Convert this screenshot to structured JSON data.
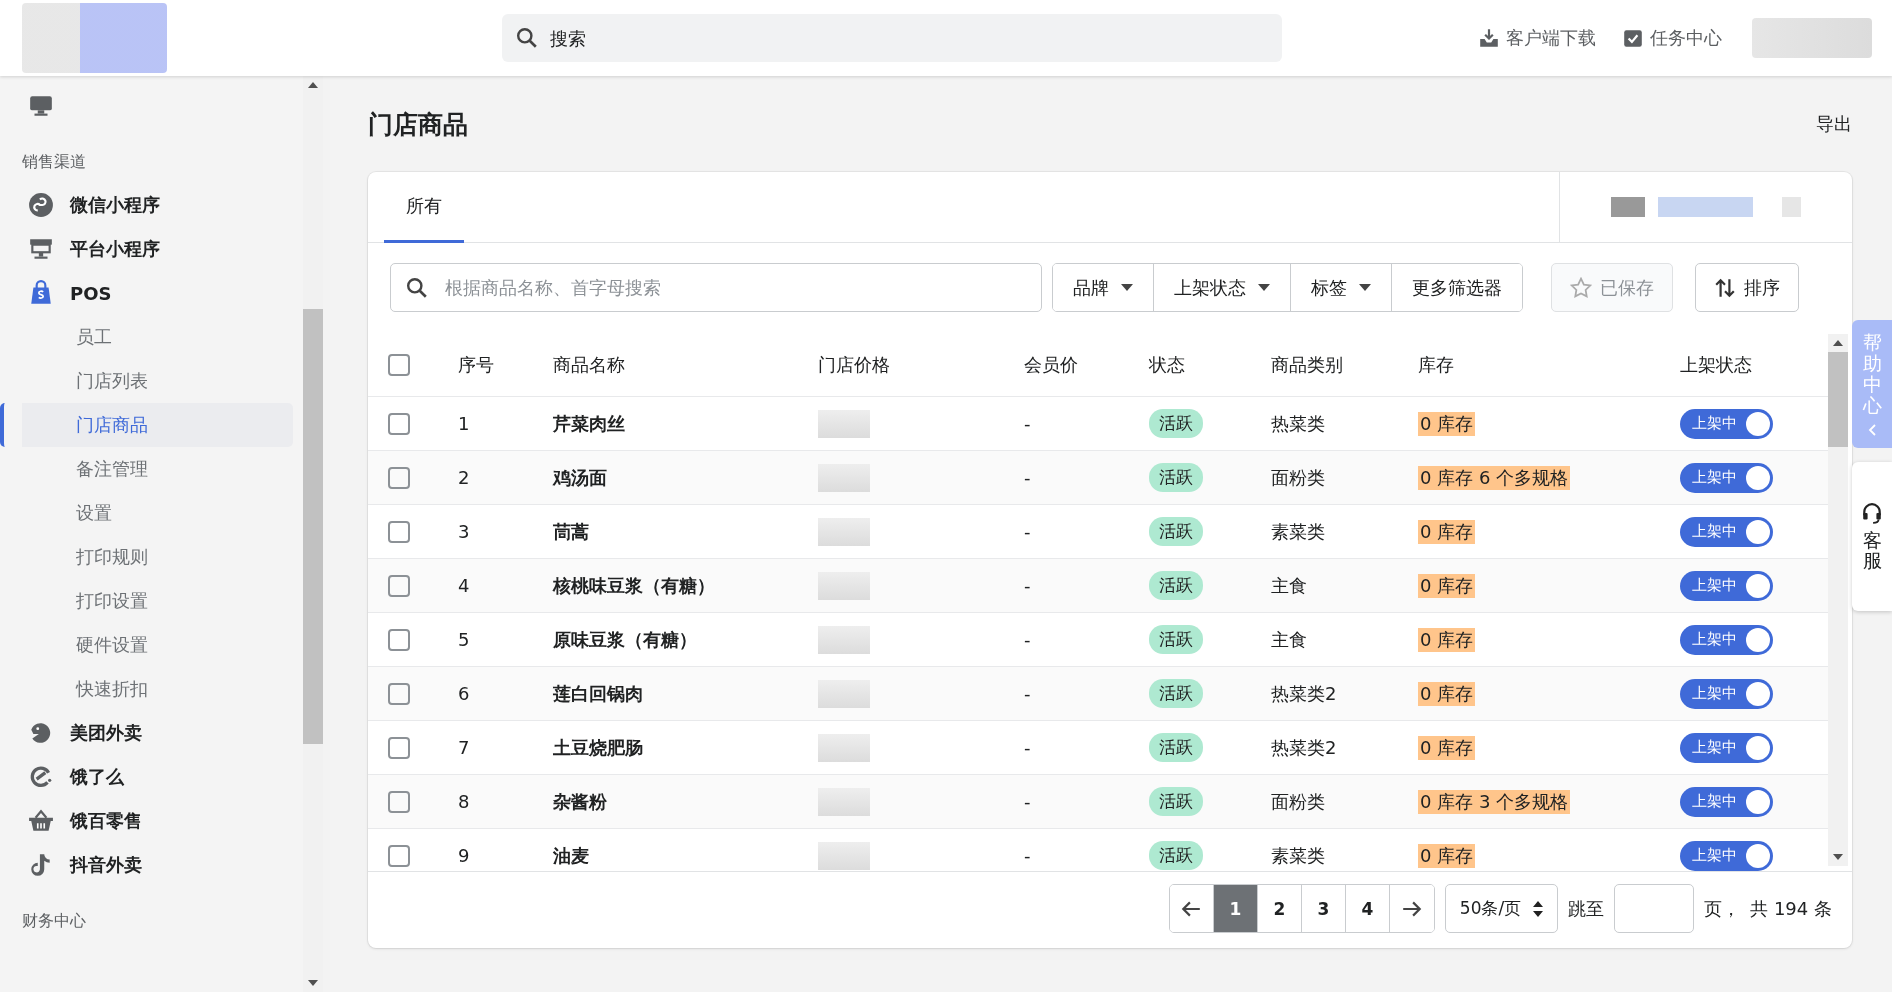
{
  "header": {
    "search_placeholder": "搜索",
    "links": [
      {
        "label": "客户端下载"
      },
      {
        "label": "任务中心"
      }
    ]
  },
  "sidebar": {
    "items": [
      {
        "kind": "channel",
        "selected": false
      },
      {
        "kind": "heading",
        "label": "销售渠道"
      },
      {
        "kind": "channel",
        "label": "微信小程序",
        "selected": false
      },
      {
        "kind": "channel",
        "label": "平台小程序",
        "selected": false
      },
      {
        "kind": "channel",
        "label": "POS",
        "selected": false
      },
      {
        "kind": "sub",
        "label": "员工",
        "selected": false
      },
      {
        "kind": "sub",
        "label": "门店列表",
        "selected": false
      },
      {
        "kind": "sub",
        "label": "门店商品",
        "selected": true
      },
      {
        "kind": "sub",
        "label": "备注管理",
        "selected": false
      },
      {
        "kind": "sub",
        "label": "设置",
        "selected": false
      },
      {
        "kind": "sub",
        "label": "打印规则",
        "selected": false
      },
      {
        "kind": "sub",
        "label": "打印设置",
        "selected": false
      },
      {
        "kind": "sub",
        "label": "硬件设置",
        "selected": false
      },
      {
        "kind": "sub",
        "label": "快速折扣",
        "selected": false
      },
      {
        "kind": "channel",
        "label": "美团外卖",
        "selected": false
      },
      {
        "kind": "channel",
        "label": "饿了么",
        "selected": false
      },
      {
        "kind": "channel",
        "label": "饿百零售",
        "selected": false
      },
      {
        "kind": "channel",
        "label": "抖音外卖",
        "selected": false
      },
      {
        "kind": "heading",
        "label": "财务中心"
      }
    ]
  },
  "page": {
    "title": "门店商品",
    "action": "导出"
  },
  "tabs": [
    {
      "label": "所有",
      "selected": true
    }
  ],
  "toolbar": {
    "search_placeholder": "根据商品名称、首字母搜索",
    "filters": [
      {
        "label": "品牌",
        "dropdown": true
      },
      {
        "label": "上架状态",
        "dropdown": true
      },
      {
        "label": "标签",
        "dropdown": true
      },
      {
        "label": "更多筛选器",
        "dropdown": false
      }
    ],
    "saved": {
      "label": "已保存",
      "disabled": true
    },
    "sort": {
      "label": "排序"
    }
  },
  "table": {
    "all_checked": false,
    "columns": [
      "序号",
      "商品名称",
      "门店价格",
      "会员价",
      "状态",
      "商品类别",
      "库存",
      "上架状态"
    ],
    "rows": [
      {
        "checked": false,
        "index": "1",
        "name": "芹菜肉丝",
        "member_price": "-",
        "status": "活跃",
        "category": "热菜类",
        "stock": "0 库存",
        "listing": "上架中",
        "on": true
      },
      {
        "checked": false,
        "index": "2",
        "name": "鸡汤面",
        "member_price": "-",
        "status": "活跃",
        "category": "面粉类",
        "stock": "0 库存 6 个多规格",
        "listing": "上架中",
        "on": true
      },
      {
        "checked": false,
        "index": "3",
        "name": "茼蒿",
        "member_price": "-",
        "status": "活跃",
        "category": "素菜类",
        "stock": "0 库存",
        "listing": "上架中",
        "on": true
      },
      {
        "checked": false,
        "index": "4",
        "name": "核桃味豆浆（有糖）",
        "member_price": "-",
        "status": "活跃",
        "category": "主食",
        "stock": "0 库存",
        "listing": "上架中",
        "on": true
      },
      {
        "checked": false,
        "index": "5",
        "name": "原味豆浆（有糖）",
        "member_price": "-",
        "status": "活跃",
        "category": "主食",
        "stock": "0 库存",
        "listing": "上架中",
        "on": true
      },
      {
        "checked": false,
        "index": "6",
        "name": "莲白回锅肉",
        "member_price": "-",
        "status": "活跃",
        "category": "热菜类2",
        "stock": "0 库存",
        "listing": "上架中",
        "on": true
      },
      {
        "checked": false,
        "index": "7",
        "name": "土豆烧肥肠",
        "member_price": "-",
        "status": "活跃",
        "category": "热菜类2",
        "stock": "0 库存",
        "listing": "上架中",
        "on": true
      },
      {
        "checked": false,
        "index": "8",
        "name": "杂酱粉",
        "member_price": "-",
        "status": "活跃",
        "category": "面粉类",
        "stock": "0 库存 3 个多规格",
        "listing": "上架中",
        "on": true
      },
      {
        "checked": false,
        "index": "9",
        "name": "油麦",
        "member_price": "-",
        "status": "活跃",
        "category": "素菜类",
        "stock": "0 库存",
        "listing": "上架中",
        "on": true
      }
    ]
  },
  "pagination": {
    "pages": [
      {
        "label": "1",
        "selected": true
      },
      {
        "label": "2",
        "selected": false
      },
      {
        "label": "3",
        "selected": false
      },
      {
        "label": "4",
        "selected": false
      }
    ],
    "page_size": "50条/页",
    "jump_label": "跳至",
    "page_suffix": "页，",
    "total": "共 194 条"
  },
  "side_tabs": {
    "help": "帮助中心",
    "service": "客服"
  }
}
